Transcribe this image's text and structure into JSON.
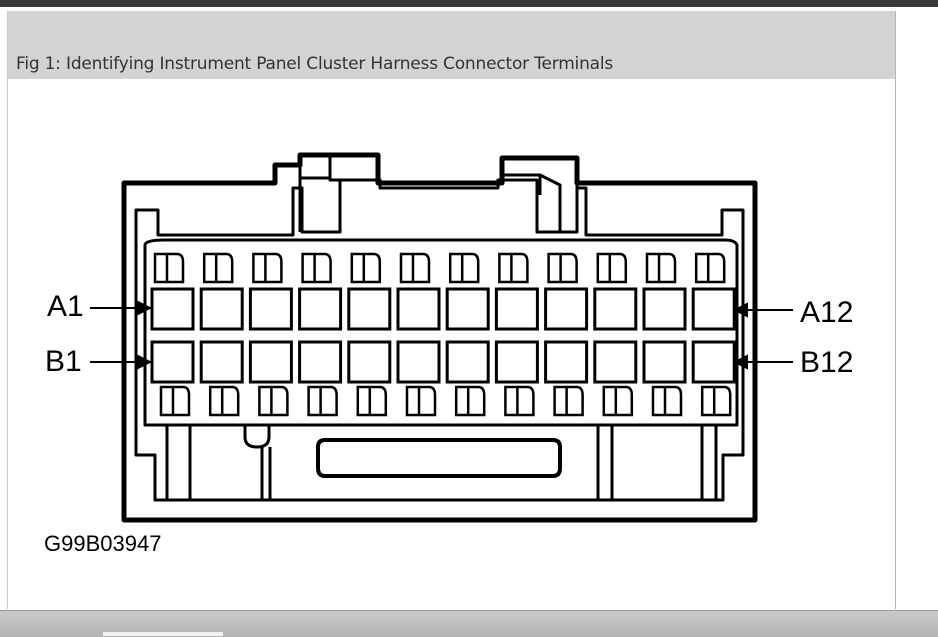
{
  "figure": {
    "caption": "Fig 1: Identifying Instrument Panel Cluster Harness Connector Terminals",
    "labels": {
      "a_first": "A1",
      "a_last": "A12",
      "b_first": "B1",
      "b_last": "B12"
    },
    "figure_code": "G99B03947",
    "terminal_rows": [
      "A",
      "B"
    ],
    "terminals_per_row": 12
  }
}
